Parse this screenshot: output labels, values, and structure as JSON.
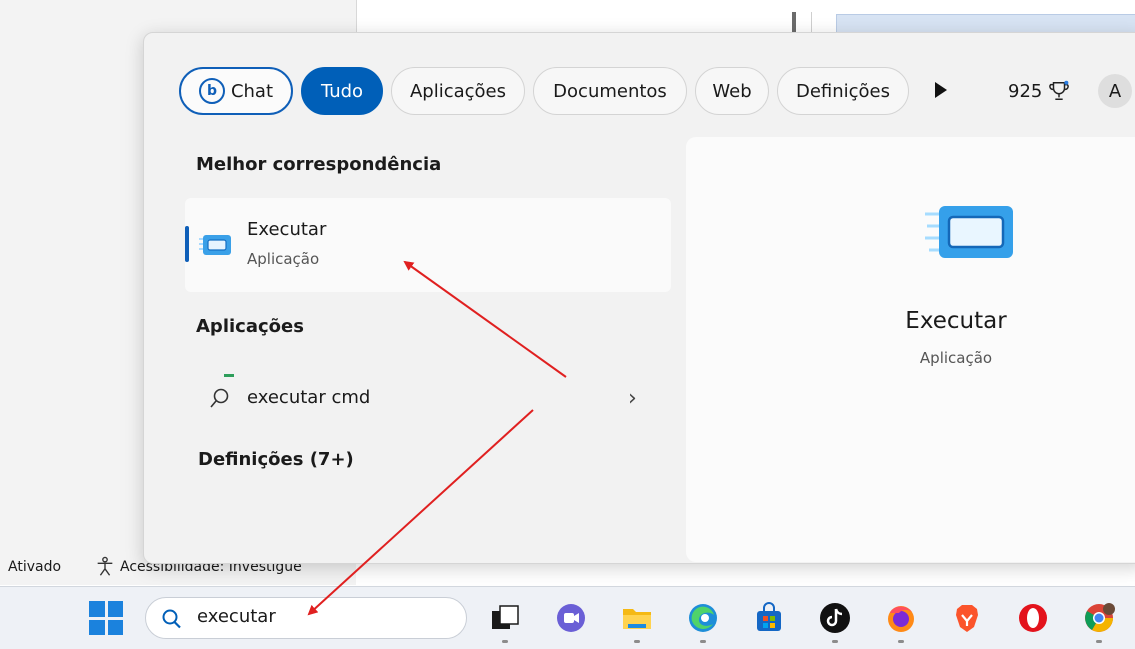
{
  "background": {
    "status_ativado": "Ativado",
    "status_accessibility": "Acessibilidade: Investigue"
  },
  "filters": {
    "chat_label": "Chat",
    "bing_glyph": "b",
    "tudo_label": "Tudo",
    "apps_label": "Aplicações",
    "docs_label": "Documentos",
    "web_label": "Web",
    "defs_label": "Definições",
    "points": "925",
    "avatar_initial": "A"
  },
  "results": {
    "best_match_heading": "Melhor correspondência",
    "best_title": "Executar",
    "best_subtitle": "Aplicação",
    "apps_heading": "Aplicações",
    "cmd_label": "executar cmd",
    "chevron": "›",
    "settings_heading": "Definições (7+)"
  },
  "preview": {
    "title": "Executar",
    "subtitle": "Aplicação"
  },
  "taskbar": {
    "search_value": "executar",
    "apps": [
      "task-view",
      "teams-chat",
      "file-explorer",
      "edge",
      "store",
      "tiktok",
      "firefox",
      "brave",
      "opera",
      "chrome"
    ]
  },
  "colors": {
    "accent": "#005fb8",
    "annotation_arrow": "#e02020"
  }
}
